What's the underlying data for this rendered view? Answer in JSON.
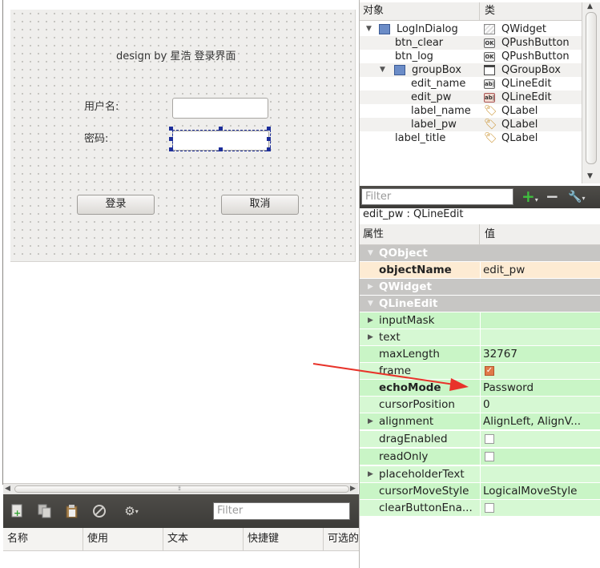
{
  "form": {
    "title": "design by 星浩 登录界面",
    "username_label": "用户名:",
    "password_label": "密码:",
    "login_button": "登录",
    "cancel_button": "取消"
  },
  "action_editor": {
    "filter_placeholder": "Filter",
    "columns": [
      "名称",
      "使用",
      "文本",
      "快捷键",
      "可选的"
    ]
  },
  "object_inspector": {
    "headers": [
      "对象",
      "类"
    ],
    "rows": [
      {
        "name": "LogInDialog",
        "class": "QWidget"
      },
      {
        "name": "btn_clear",
        "class": "QPushButton"
      },
      {
        "name": "btn_log",
        "class": "QPushButton"
      },
      {
        "name": "groupBox",
        "class": "QGroupBox"
      },
      {
        "name": "edit_name",
        "class": "QLineEdit"
      },
      {
        "name": "edit_pw",
        "class": "QLineEdit"
      },
      {
        "name": "label_name",
        "class": "QLabel"
      },
      {
        "name": "label_pw",
        "class": "QLabel"
      },
      {
        "name": "label_title",
        "class": "QLabel"
      }
    ]
  },
  "property_editor": {
    "filter_placeholder": "Filter",
    "selected_object": "edit_pw : QLineEdit",
    "headers": [
      "属性",
      "值"
    ],
    "rows": [
      {
        "name": "QObject",
        "value": ""
      },
      {
        "name": "objectName",
        "value": "edit_pw"
      },
      {
        "name": "QWidget",
        "value": ""
      },
      {
        "name": "QLineEdit",
        "value": ""
      },
      {
        "name": "inputMask",
        "value": ""
      },
      {
        "name": "text",
        "value": ""
      },
      {
        "name": "maxLength",
        "value": "32767"
      },
      {
        "name": "frame",
        "value": ""
      },
      {
        "name": "echoMode",
        "value": "Password"
      },
      {
        "name": "cursorPosition",
        "value": "0"
      },
      {
        "name": "alignment",
        "value": "AlignLeft, AlignV..."
      },
      {
        "name": "dragEnabled",
        "value": ""
      },
      {
        "name": "readOnly",
        "value": ""
      },
      {
        "name": "placeholderText",
        "value": ""
      },
      {
        "name": "cursorMoveStyle",
        "value": "LogicalMoveStyle"
      },
      {
        "name": "clearButtonEna...",
        "value": ""
      }
    ]
  },
  "colors": {
    "category_bg": "#c7c6c4",
    "lineedit_prop_bg": "#c9f5c6",
    "selection_handle": "#1d2e9a",
    "annotation_arrow": "#e8332a"
  }
}
